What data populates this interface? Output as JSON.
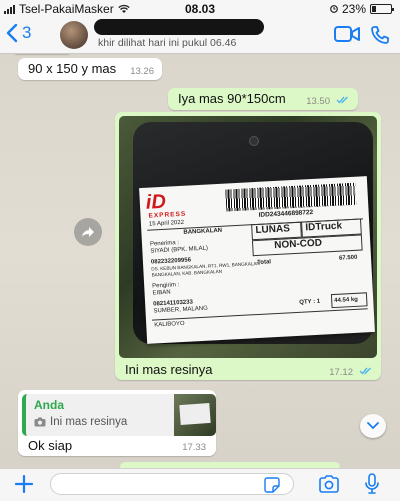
{
  "status_bar": {
    "carrier": "Tsel-PakaiMasker",
    "time": "08.03",
    "battery_percent": "23%",
    "battery_level": 0.23
  },
  "header": {
    "back_count": "3",
    "last_seen": "khir dilihat hari ini pukul 06.46"
  },
  "messages": [
    {
      "type": "in",
      "text": "90 x 150 y mas",
      "time": "13.26"
    },
    {
      "type": "out",
      "text": "Iya mas 90*150cm",
      "time": "13.50",
      "status": "read"
    },
    {
      "type": "out",
      "image": true,
      "caption": "Ini mas resinya",
      "time": "17.12",
      "status": "read",
      "receipt": {
        "brand": "iD",
        "brand_sub": "EXPRESS",
        "date": "15 April 2022",
        "tracking": "IDD243446898722",
        "origin": "BANGKALAN",
        "payment": "LUNAS",
        "service": "IDTruck",
        "cod": "NON-COD",
        "recipient_label": "Penerima :",
        "recipient": "SIYADI (BPK. MILAL)",
        "recipient_phone": "082232209956",
        "recipient_addr": "DS. KEBUN BANGKALAN, RT1, RW1, BANGKALAN",
        "recipient_city": "BANGKALAN, KAB. BANGKALAN",
        "sender_label": "Pengirim :",
        "sender": "EIBAN",
        "sender_phone": "082141103233",
        "sender_city": "SUMBER, MALANG",
        "total_label": "Total",
        "total": "67.500",
        "qty": "QTY : 1",
        "weight": "44.54 kg",
        "footer": "KALIBOYO"
      }
    },
    {
      "type": "in",
      "quote_author": "Anda",
      "quote_text": "Ini mas resinya",
      "text": "Ok siap",
      "time": "17.33"
    }
  ],
  "input": {
    "placeholder": ""
  },
  "colors": {
    "accent": "#1a7ef2",
    "outgoing_bubble": "#dcf8c6",
    "incoming_bubble": "#ffffff",
    "quote_green": "#2fa84f",
    "read_ticks": "#4fb6ec"
  }
}
